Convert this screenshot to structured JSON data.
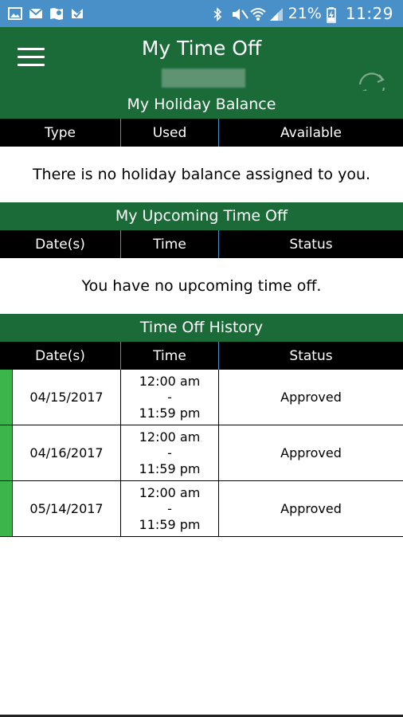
{
  "status_bar": {
    "battery_percent": "21%",
    "time": "11:29",
    "icons": [
      "gallery-icon",
      "gmail-icon",
      "maps-icon",
      "check-app-icon",
      "bluetooth-icon",
      "mute-icon",
      "wifi-icon",
      "signal-icon",
      "battery-icon"
    ]
  },
  "app_bar": {
    "title": "My Time Off",
    "menu_icon": "hamburger-menu-icon",
    "refresh_icon": "refresh-icon"
  },
  "holiday_balance": {
    "title": "My Holiday Balance",
    "columns": [
      "Type",
      "Used",
      "Available"
    ],
    "empty_message": "There is no holiday balance assigned to you."
  },
  "upcoming": {
    "title": "My Upcoming Time Off",
    "columns": [
      "Date(s)",
      "Time",
      "Status"
    ],
    "empty_message": "You have no upcoming time off."
  },
  "history": {
    "title": "Time Off History",
    "columns": [
      "Date(s)",
      "Time",
      "Status"
    ],
    "rows": [
      {
        "date": "04/15/2017",
        "start": "12:00 am",
        "sep": "-",
        "end": "11:59 pm",
        "status": "Approved"
      },
      {
        "date": "04/16/2017",
        "start": "12:00 am",
        "sep": "-",
        "end": "11:59 pm",
        "status": "Approved"
      },
      {
        "date": "05/14/2017",
        "start": "12:00 am",
        "sep": "-",
        "end": "11:59 pm",
        "status": "Approved"
      }
    ]
  },
  "colors": {
    "status_bar": "#4a90c8",
    "primary_green": "#1a6b38",
    "approved_marker": "#3cb54a",
    "header_black": "#000000"
  }
}
